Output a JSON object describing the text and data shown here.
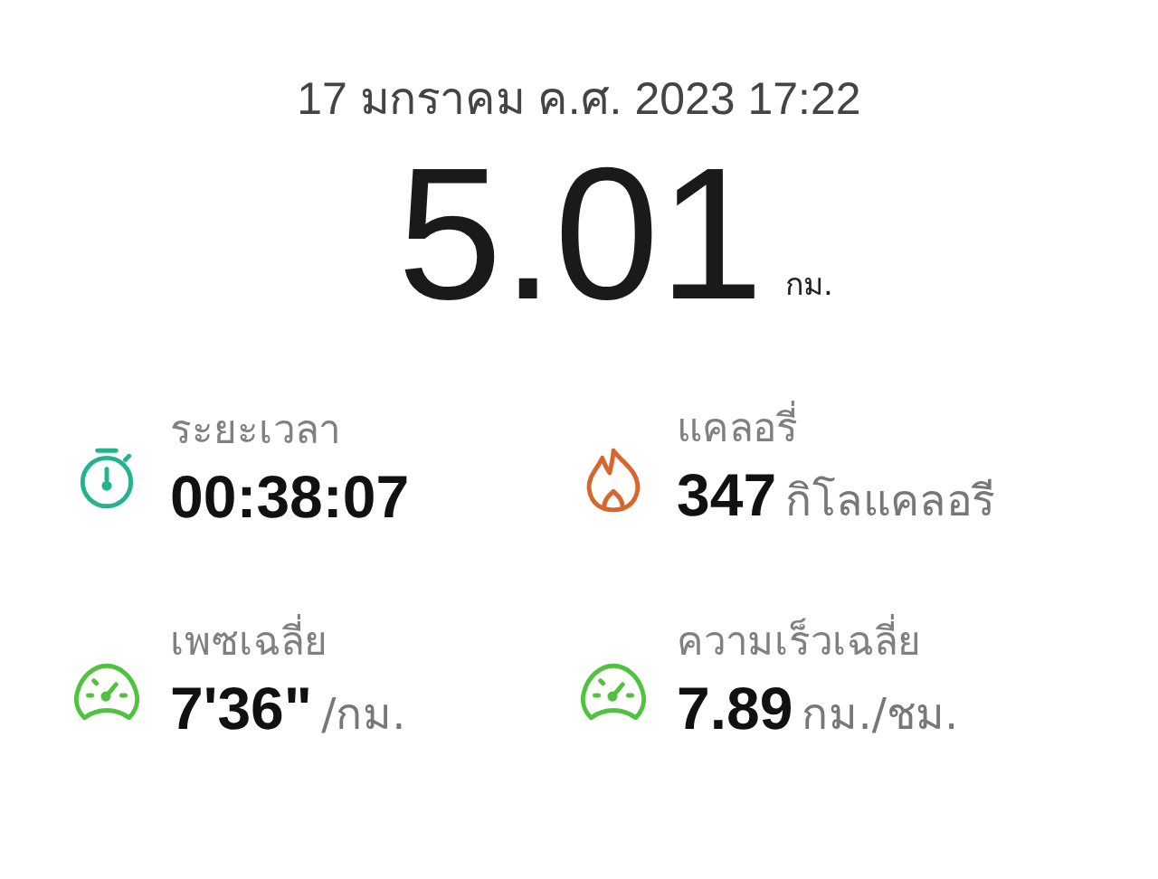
{
  "date": "17 มกราคม ค.ศ. 2023 17:22",
  "distance": {
    "value": "5.01",
    "unit": "กม."
  },
  "stats": [
    {
      "kind": "stopwatch",
      "color": "#22b48e",
      "label": "ระยะเวลา",
      "value": "00:38:07"
    },
    {
      "kind": "flame",
      "color": "#d8652e",
      "label": "แคลอรี่",
      "value": "347",
      "unit": "กิโลแคลอรี"
    },
    {
      "kind": "gauge",
      "color": "#4fc23e",
      "label": "เพซเฉลี่ย",
      "value": "7'36\"",
      "unit": "/กม."
    },
    {
      "kind": "gauge",
      "color": "#4fc23e",
      "label": "ความเร็วเฉลี่ย",
      "value": "7.89",
      "unit": "กม./ชม."
    }
  ]
}
